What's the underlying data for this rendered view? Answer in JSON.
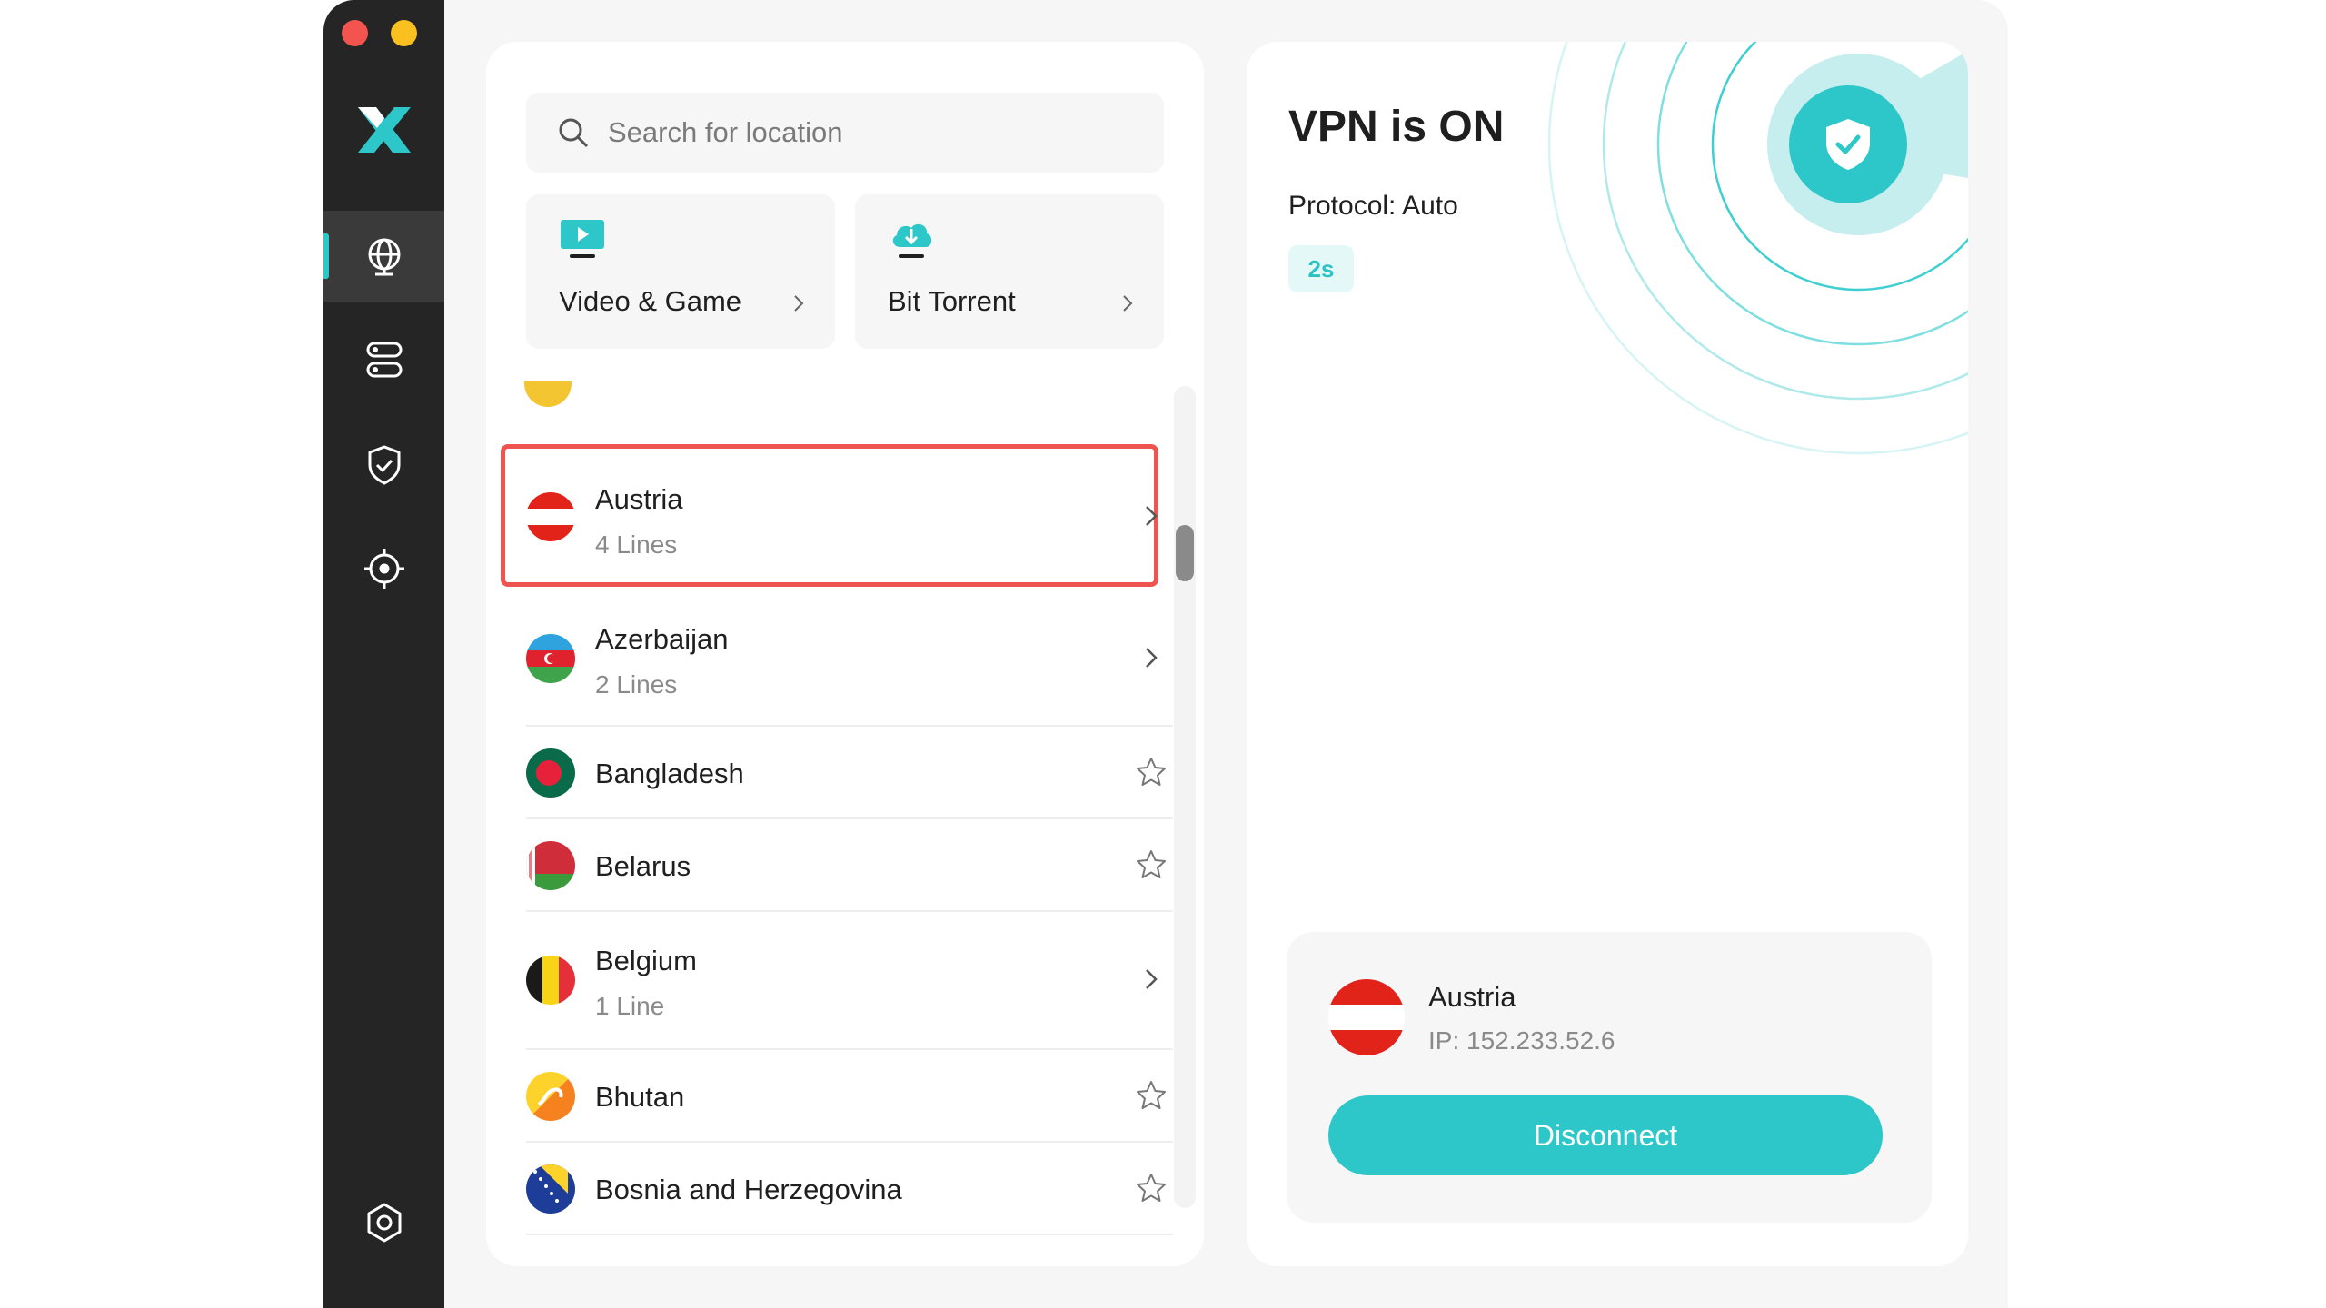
{
  "sidebar": {
    "logo": "x-logo-icon",
    "nav": [
      {
        "name": "nav-locations",
        "icon": "globe-icon",
        "active": true
      },
      {
        "name": "nav-servers",
        "icon": "server-icon",
        "active": false
      },
      {
        "name": "nav-security",
        "icon": "shield-check-icon",
        "active": false
      },
      {
        "name": "nav-target",
        "icon": "crosshair-icon",
        "active": false
      },
      {
        "name": "nav-settings",
        "icon": "gear-icon",
        "active": false
      }
    ],
    "accent": "#2ec7c9"
  },
  "search": {
    "placeholder": "Search for location",
    "value": ""
  },
  "categories": [
    {
      "label": "Video & Game",
      "icon": "monitor-play-icon"
    },
    {
      "label": "Bit Torrent",
      "icon": "cloud-download-icon"
    }
  ],
  "locations": [
    {
      "name": "Austria",
      "sub": "4 Lines",
      "action": "chevron",
      "highlighted": true
    },
    {
      "name": "Azerbaijan",
      "sub": "2 Lines",
      "action": "chevron"
    },
    {
      "name": "Bangladesh",
      "sub": "",
      "action": "star"
    },
    {
      "name": "Belarus",
      "sub": "",
      "action": "star"
    },
    {
      "name": "Belgium",
      "sub": "1 Line",
      "action": "chevron"
    },
    {
      "name": "Bhutan",
      "sub": "",
      "action": "star"
    },
    {
      "name": "Bosnia and Herzegovina",
      "sub": "",
      "action": "star"
    }
  ],
  "status": {
    "title": "VPN is ON",
    "protocol": "Protocol: Auto",
    "timer": "2s",
    "badge_icon": "shield-check-icon"
  },
  "connection": {
    "country": "Austria",
    "ip": "IP: 152.233.52.6",
    "button": "Disconnect"
  },
  "colors": {
    "accent": "#2ec7c9",
    "highlight": "#ef5550",
    "sidebar": "#252525"
  }
}
